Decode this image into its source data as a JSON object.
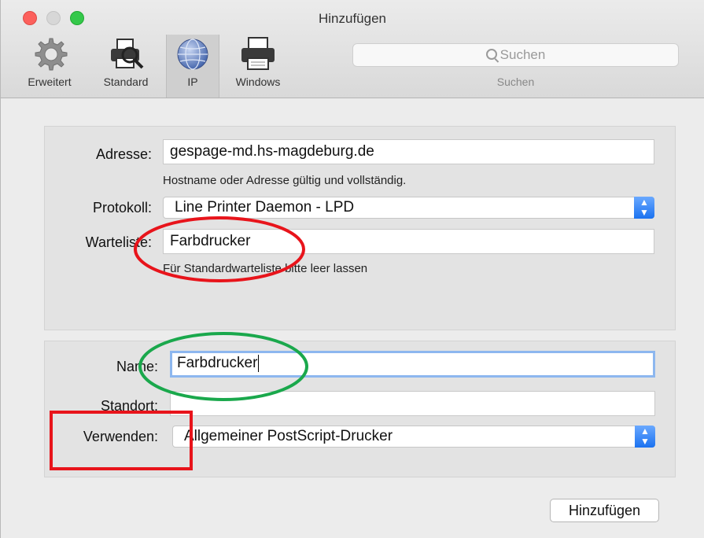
{
  "window": {
    "title": "Hinzufügen"
  },
  "toolbar": {
    "items": [
      {
        "label": "Erweitert",
        "icon": "gear-icon"
      },
      {
        "label": "Standard",
        "icon": "printer-search-icon"
      },
      {
        "label": "IP",
        "icon": "globe-icon"
      },
      {
        "label": "Windows",
        "icon": "printer-icon"
      }
    ],
    "selected": "IP"
  },
  "search": {
    "placeholder": "Suchen",
    "caption": "Suchen"
  },
  "connection": {
    "address_label": "Adresse:",
    "address_value": "gespage-md.hs-magdeburg.de",
    "address_hint": "Hostname oder Adresse gültig und vollständig.",
    "protocol_label": "Protokoll:",
    "protocol_value": "Line Printer Daemon - LPD",
    "queue_label": "Warteliste:",
    "queue_value": "Farbdrucker",
    "queue_hint": "Für Standardwarteliste bitte leer lassen"
  },
  "printer": {
    "name_label": "Name:",
    "name_value": "Farbdrucker",
    "location_label": "Standort:",
    "location_value": "",
    "use_label": "Verwenden:",
    "use_value": "Allgemeiner PostScript-Drucker"
  },
  "add_button": "Hinzufügen",
  "colors": {
    "annotation_red": "#e8141b",
    "annotation_green": "#1aa84c",
    "select_accent": "#1b72f0",
    "focus_ring": "#8db7ef"
  }
}
